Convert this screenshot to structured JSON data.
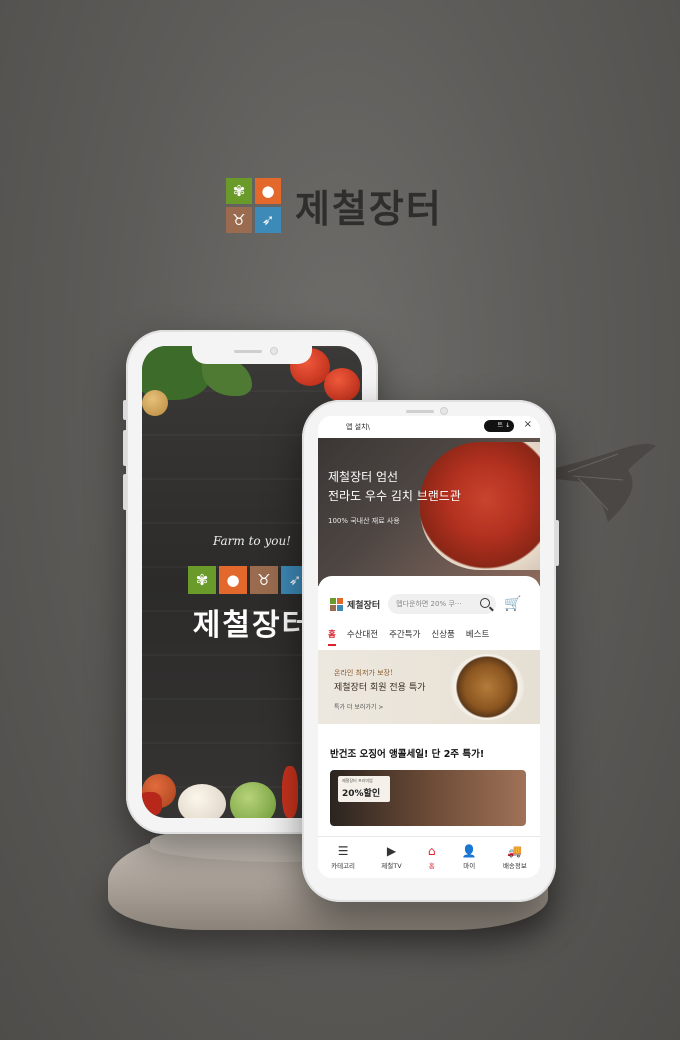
{
  "brand": {
    "name": "제철장터",
    "tagline": "Farm to you!",
    "icons": [
      "wheat-icon",
      "apple-icon",
      "cow-icon",
      "fish-icon"
    ],
    "colors": {
      "green": "#6a9a2a",
      "orange": "#e3682b",
      "brown": "#9a6b4e",
      "blue": "#3d8ab8",
      "accent": "#d9232e"
    }
  },
  "statusbar": {
    "left": "앱 설치\\",
    "pill": "트 ↓",
    "close": "×"
  },
  "hero": {
    "title_line1": "제철장터 엄선",
    "title_line2": "전라도 우수 김치 브랜드관",
    "subtitle": "100% 국내산 재료 사용"
  },
  "header": {
    "brand": "제철장터",
    "search_placeholder": "멥다운하면 20% 쿠···"
  },
  "tabs": [
    {
      "label": "홈"
    },
    {
      "label": "수산대전"
    },
    {
      "label": "주간특가"
    },
    {
      "label": "신상품"
    },
    {
      "label": "베스트"
    }
  ],
  "banner": {
    "small": "온라인 최저가 보장!",
    "title": "제철장터 회원 전용 특가",
    "link": "특가 더 보러가기 >"
  },
  "promo": {
    "title": "반건조 오징어 앵콜세일! 단 2주 특가!",
    "badge_small": "제철장터 프리미엄",
    "badge_big": "20%할인"
  },
  "bottom_nav": [
    {
      "label": "카테고리",
      "glyph": "☰"
    },
    {
      "label": "제철TV",
      "glyph": "▶"
    },
    {
      "label": "홈",
      "glyph": "⌂"
    },
    {
      "label": "마이",
      "glyph": "👤"
    },
    {
      "label": "배송정보",
      "glyph": "🚚"
    }
  ]
}
